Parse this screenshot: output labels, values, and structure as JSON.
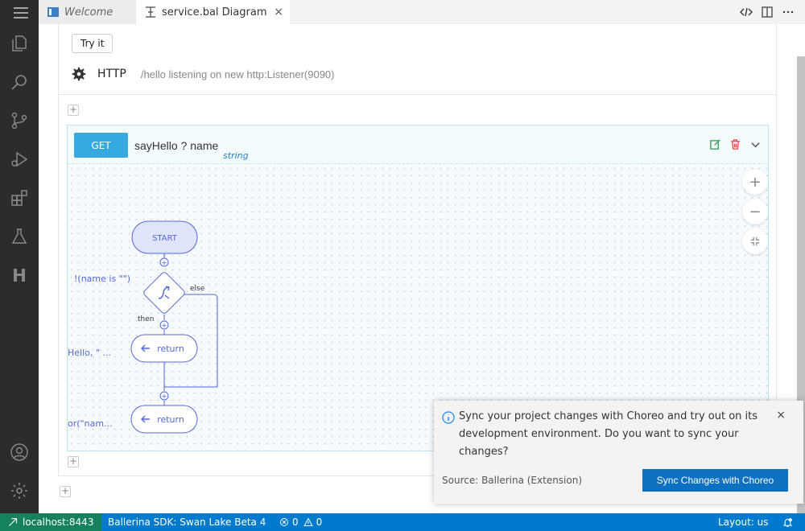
{
  "tabs": {
    "welcome": "Welcome",
    "active": "service.bal Diagram",
    "close": "×"
  },
  "service": {
    "try_it": "Try it",
    "type": "HTTP",
    "description": "/hello listening on new http:Listener(9090)"
  },
  "resource": {
    "method": "GET",
    "name": "sayHello ? name",
    "param_type": "string"
  },
  "diagram": {
    "start": "START",
    "condition": "!(name is \"\")",
    "else_label": "else",
    "then_label": "then",
    "return1": "return",
    "return1_expr": "Hello, \" ...",
    "return2": "return",
    "return2_expr": "or(\"nam..."
  },
  "zoom": {
    "in": "+",
    "out": "−"
  },
  "notification": {
    "message": "Sync your project changes with Choreo and try out on its development environment. Do you want to sync your changes?",
    "source": "Source: Ballerina (Extension)",
    "action": "Sync Changes with Choreo",
    "close": "×"
  },
  "statusbar": {
    "remote": "localhost:8443",
    "sdk": "Ballerina SDK: Swan Lake Beta 4",
    "errors": "0",
    "warnings": "0",
    "layout": "Layout: us"
  },
  "colors": {
    "accent": "#36a9e1",
    "statusbar": "#007acc",
    "remote": "#16825d",
    "button": "#0e70c0"
  }
}
